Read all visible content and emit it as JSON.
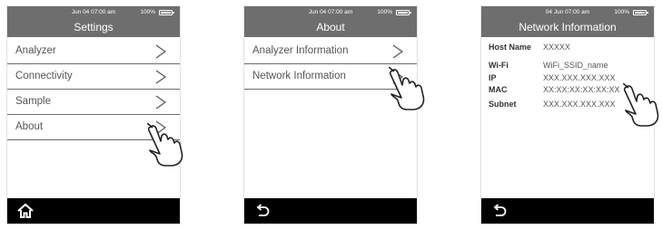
{
  "screens": [
    {
      "status_time": "Jun 04  07:00 am",
      "battery": "100%",
      "title": "Settings",
      "menu": [
        "Analyzer",
        "Connectivity",
        "Sample",
        "About"
      ],
      "nav_icon": "home-icon"
    },
    {
      "status_time": "Jun 04  07:00 am",
      "battery": "100%",
      "title": "About",
      "menu": [
        "Analyzer Information",
        "Network Information"
      ],
      "nav_icon": "back-arrow-icon"
    },
    {
      "status_time": "04 Jun  07:00 am",
      "battery": "100%",
      "title": "Network Information",
      "info": [
        {
          "key": "Host Name",
          "value": "XXXXX"
        },
        {
          "key": "Wi-Fi",
          "value": "WiFi_SSID_name"
        },
        {
          "key": "IP",
          "value": "XXX.XXX.XXX.XXX"
        },
        {
          "key": "MAC",
          "value": "XX:XX:XX:XX:XX:XX"
        },
        {
          "key": "Subnet",
          "value": "XXX.XXX.XXX.XXX"
        }
      ],
      "nav_icon": "back-arrow-icon"
    }
  ],
  "colors": {
    "header": "#6e6e6e",
    "bottom_bar": "#000000",
    "divider": "#6a6a6a"
  }
}
